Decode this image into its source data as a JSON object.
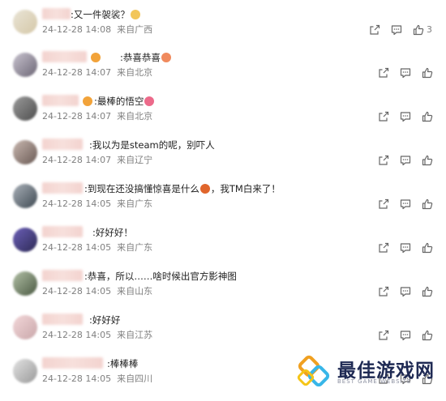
{
  "comments": [
    {
      "text": ":又一件袈裟？",
      "emoji": "#f2c65a",
      "date": "24-12-28 14:08",
      "location": "来自广西",
      "likes": "3"
    },
    {
      "text": ":恭喜恭喜",
      "badge": "#f2a33a",
      "emoji": "#f08a5d",
      "date": "24-12-28 14:07",
      "location": "来自北京",
      "likes": ""
    },
    {
      "text": ":最棒的悟空",
      "badge": "#f2a33a",
      "emoji": "#ec6a8a",
      "date": "24-12-28 14:07",
      "location": "来自北京",
      "likes": ""
    },
    {
      "text": ":我以为是steam的呢，别吓人",
      "date": "24-12-28 14:07",
      "location": "来自辽宁",
      "likes": ""
    },
    {
      "text_before": ":到现在还没搞懂惊喜是什么",
      "emoji": "#e0652b",
      "text_after": "，我TM白来了！",
      "date": "24-12-28 14:05",
      "location": "来自广东",
      "likes": ""
    },
    {
      "text": ":好好好！",
      "date": "24-12-28 14:05",
      "location": "来自广东",
      "likes": ""
    },
    {
      "text": ":恭喜，所以……啥时候出官方影神图",
      "date": "24-12-28 14:05",
      "location": "来自山东",
      "likes": ""
    },
    {
      "text": ":好好好",
      "date": "24-12-28 14:05",
      "location": "来自江苏",
      "likes": ""
    },
    {
      "text": ":棒棒棒",
      "date": "24-12-28 14:05",
      "location": "来自四川",
      "likes": ""
    }
  ],
  "icons": {
    "share": "share-icon",
    "reply": "comment-icon",
    "like": "thumbs-up-icon"
  },
  "watermark": {
    "title": "最佳游戏网",
    "subtitle": "BEST GAME WEBSITE"
  }
}
